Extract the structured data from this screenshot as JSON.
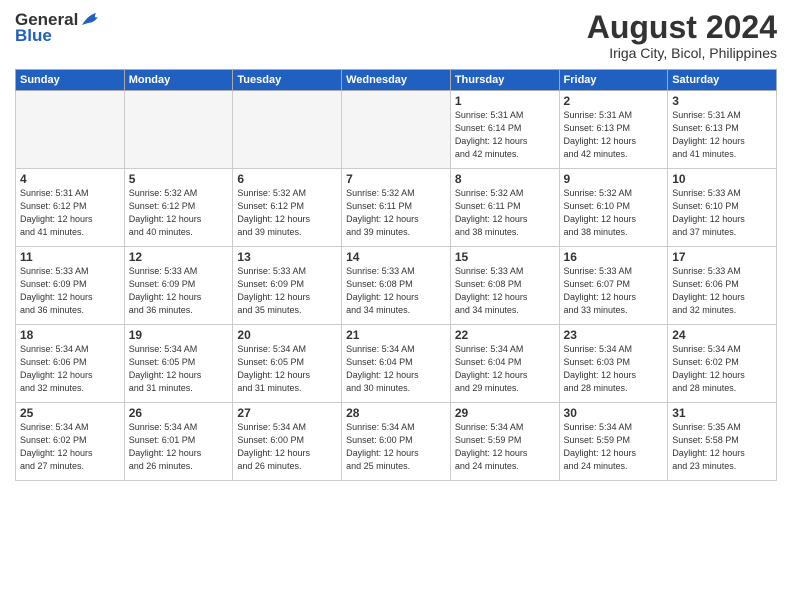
{
  "header": {
    "logo_line1": "General",
    "logo_line2": "Blue",
    "month_title": "August 2024",
    "location": "Iriga City, Bicol, Philippines"
  },
  "weekdays": [
    "Sunday",
    "Monday",
    "Tuesday",
    "Wednesday",
    "Thursday",
    "Friday",
    "Saturday"
  ],
  "weeks": [
    [
      {
        "day": "",
        "info": "",
        "empty": true
      },
      {
        "day": "",
        "info": "",
        "empty": true
      },
      {
        "day": "",
        "info": "",
        "empty": true
      },
      {
        "day": "",
        "info": "",
        "empty": true
      },
      {
        "day": "1",
        "info": "Sunrise: 5:31 AM\nSunset: 6:14 PM\nDaylight: 12 hours\nand 42 minutes."
      },
      {
        "day": "2",
        "info": "Sunrise: 5:31 AM\nSunset: 6:13 PM\nDaylight: 12 hours\nand 42 minutes."
      },
      {
        "day": "3",
        "info": "Sunrise: 5:31 AM\nSunset: 6:13 PM\nDaylight: 12 hours\nand 41 minutes."
      }
    ],
    [
      {
        "day": "4",
        "info": "Sunrise: 5:31 AM\nSunset: 6:12 PM\nDaylight: 12 hours\nand 41 minutes."
      },
      {
        "day": "5",
        "info": "Sunrise: 5:32 AM\nSunset: 6:12 PM\nDaylight: 12 hours\nand 40 minutes."
      },
      {
        "day": "6",
        "info": "Sunrise: 5:32 AM\nSunset: 6:12 PM\nDaylight: 12 hours\nand 39 minutes."
      },
      {
        "day": "7",
        "info": "Sunrise: 5:32 AM\nSunset: 6:11 PM\nDaylight: 12 hours\nand 39 minutes."
      },
      {
        "day": "8",
        "info": "Sunrise: 5:32 AM\nSunset: 6:11 PM\nDaylight: 12 hours\nand 38 minutes."
      },
      {
        "day": "9",
        "info": "Sunrise: 5:32 AM\nSunset: 6:10 PM\nDaylight: 12 hours\nand 38 minutes."
      },
      {
        "day": "10",
        "info": "Sunrise: 5:33 AM\nSunset: 6:10 PM\nDaylight: 12 hours\nand 37 minutes."
      }
    ],
    [
      {
        "day": "11",
        "info": "Sunrise: 5:33 AM\nSunset: 6:09 PM\nDaylight: 12 hours\nand 36 minutes."
      },
      {
        "day": "12",
        "info": "Sunrise: 5:33 AM\nSunset: 6:09 PM\nDaylight: 12 hours\nand 36 minutes."
      },
      {
        "day": "13",
        "info": "Sunrise: 5:33 AM\nSunset: 6:09 PM\nDaylight: 12 hours\nand 35 minutes."
      },
      {
        "day": "14",
        "info": "Sunrise: 5:33 AM\nSunset: 6:08 PM\nDaylight: 12 hours\nand 34 minutes."
      },
      {
        "day": "15",
        "info": "Sunrise: 5:33 AM\nSunset: 6:08 PM\nDaylight: 12 hours\nand 34 minutes."
      },
      {
        "day": "16",
        "info": "Sunrise: 5:33 AM\nSunset: 6:07 PM\nDaylight: 12 hours\nand 33 minutes."
      },
      {
        "day": "17",
        "info": "Sunrise: 5:33 AM\nSunset: 6:06 PM\nDaylight: 12 hours\nand 32 minutes."
      }
    ],
    [
      {
        "day": "18",
        "info": "Sunrise: 5:34 AM\nSunset: 6:06 PM\nDaylight: 12 hours\nand 32 minutes."
      },
      {
        "day": "19",
        "info": "Sunrise: 5:34 AM\nSunset: 6:05 PM\nDaylight: 12 hours\nand 31 minutes."
      },
      {
        "day": "20",
        "info": "Sunrise: 5:34 AM\nSunset: 6:05 PM\nDaylight: 12 hours\nand 31 minutes."
      },
      {
        "day": "21",
        "info": "Sunrise: 5:34 AM\nSunset: 6:04 PM\nDaylight: 12 hours\nand 30 minutes."
      },
      {
        "day": "22",
        "info": "Sunrise: 5:34 AM\nSunset: 6:04 PM\nDaylight: 12 hours\nand 29 minutes."
      },
      {
        "day": "23",
        "info": "Sunrise: 5:34 AM\nSunset: 6:03 PM\nDaylight: 12 hours\nand 28 minutes."
      },
      {
        "day": "24",
        "info": "Sunrise: 5:34 AM\nSunset: 6:02 PM\nDaylight: 12 hours\nand 28 minutes."
      }
    ],
    [
      {
        "day": "25",
        "info": "Sunrise: 5:34 AM\nSunset: 6:02 PM\nDaylight: 12 hours\nand 27 minutes."
      },
      {
        "day": "26",
        "info": "Sunrise: 5:34 AM\nSunset: 6:01 PM\nDaylight: 12 hours\nand 26 minutes."
      },
      {
        "day": "27",
        "info": "Sunrise: 5:34 AM\nSunset: 6:00 PM\nDaylight: 12 hours\nand 26 minutes."
      },
      {
        "day": "28",
        "info": "Sunrise: 5:34 AM\nSunset: 6:00 PM\nDaylight: 12 hours\nand 25 minutes."
      },
      {
        "day": "29",
        "info": "Sunrise: 5:34 AM\nSunset: 5:59 PM\nDaylight: 12 hours\nand 24 minutes."
      },
      {
        "day": "30",
        "info": "Sunrise: 5:34 AM\nSunset: 5:59 PM\nDaylight: 12 hours\nand 24 minutes."
      },
      {
        "day": "31",
        "info": "Sunrise: 5:35 AM\nSunset: 5:58 PM\nDaylight: 12 hours\nand 23 minutes."
      }
    ]
  ]
}
